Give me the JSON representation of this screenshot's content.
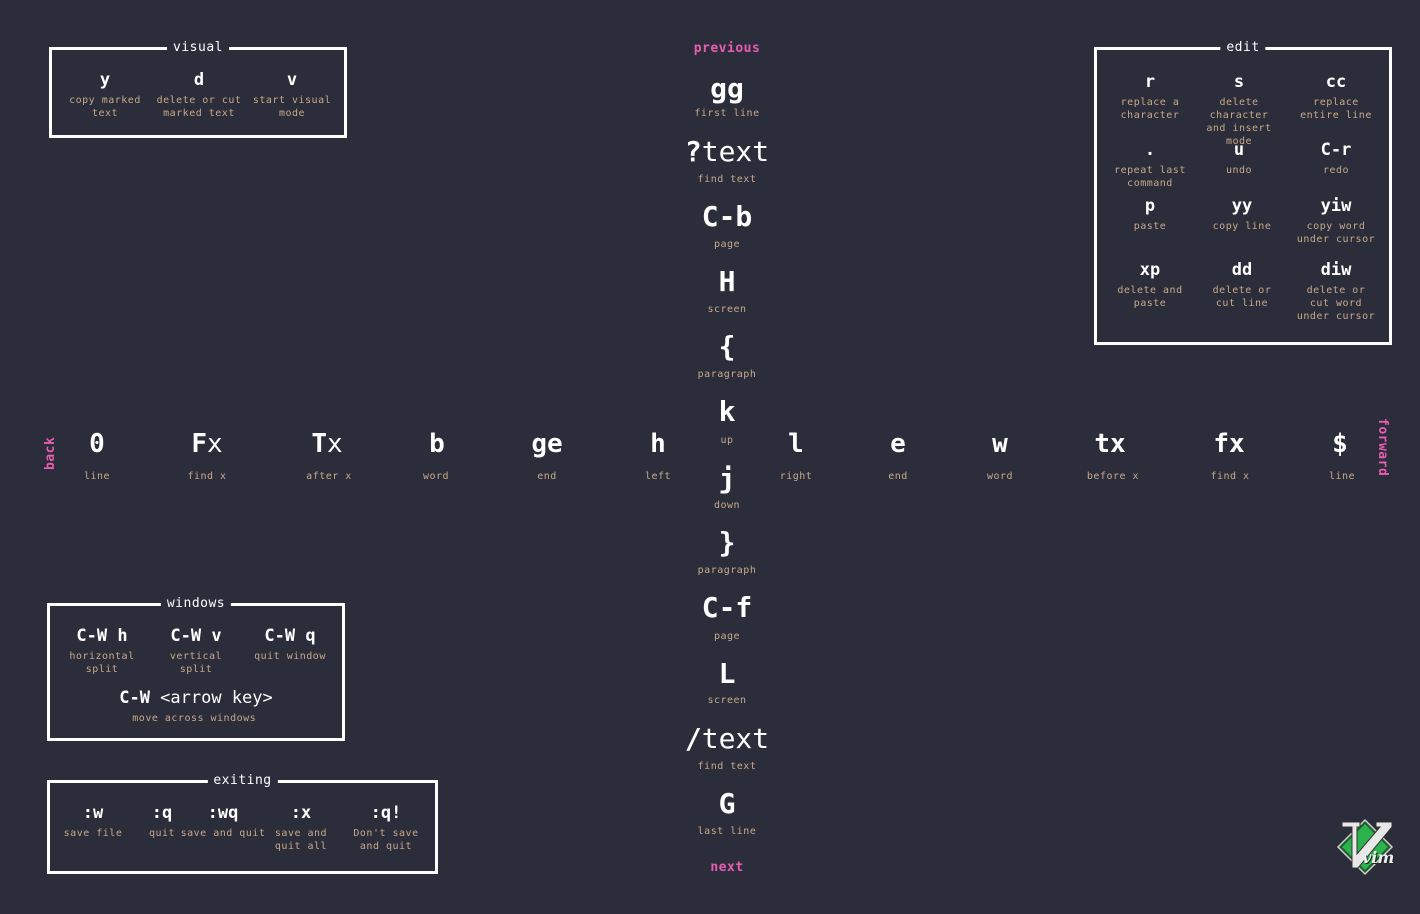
{
  "visual": {
    "title": "visual",
    "items": [
      {
        "key": "y",
        "desc": "copy marked text"
      },
      {
        "key": "d",
        "desc": "delete or cut marked text"
      },
      {
        "key": "v",
        "desc": "start visual mode"
      }
    ]
  },
  "edit": {
    "title": "edit",
    "items": [
      {
        "key": "r",
        "desc": "replace a character"
      },
      {
        "key": "s",
        "desc": "delete character and insert mode"
      },
      {
        "key": "cc",
        "desc": "replace entire line"
      },
      {
        "key": ".",
        "desc": "repeat last command"
      },
      {
        "key": "u",
        "desc": "undo"
      },
      {
        "key": "C-r",
        "desc": "redo"
      },
      {
        "key": "p",
        "desc": "paste"
      },
      {
        "key": "yy",
        "desc": "copy line"
      },
      {
        "key": "yiw",
        "desc": "copy word under cursor"
      },
      {
        "key": "xp",
        "desc": "delete and paste"
      },
      {
        "key": "dd",
        "desc": "delete or cut line"
      },
      {
        "key": "diw",
        "desc": "delete or cut word under cursor"
      }
    ]
  },
  "windows": {
    "title": "windows",
    "items": [
      {
        "key": "C-W h",
        "desc": "horizontal split"
      },
      {
        "key": "C-W v",
        "desc": "vertical split"
      },
      {
        "key": "C-W q",
        "desc": "quit window"
      }
    ],
    "arrow": {
      "key_prefix": "C-W ",
      "key_suffix": "<arrow key>",
      "desc": "move across windows"
    }
  },
  "exiting": {
    "title": "exiting",
    "items": [
      {
        "key": ":w",
        "desc": "save file"
      },
      {
        "key": ":q",
        "desc": "quit"
      },
      {
        "key": ":wq",
        "desc": "save and quit"
      },
      {
        "key": ":x",
        "desc": "save and quit all"
      },
      {
        "key": ":q!",
        "desc": "Don't save and quit"
      }
    ]
  },
  "vertical": {
    "previous": "previous",
    "next": "next",
    "items": [
      {
        "key": "gg",
        "desc": "first line"
      },
      {
        "key": "?text",
        "desc": "find text"
      },
      {
        "key": "C-b",
        "desc": "page"
      },
      {
        "key": "H",
        "desc": "screen"
      },
      {
        "key": "{",
        "desc": "paragraph"
      },
      {
        "key": "k",
        "desc": "up"
      },
      {
        "key": "j",
        "desc": "down"
      },
      {
        "key": "}",
        "desc": "paragraph"
      },
      {
        "key": "C-f",
        "desc": "page"
      },
      {
        "key": "L",
        "desc": "screen"
      },
      {
        "key": "/text",
        "desc": "find text"
      },
      {
        "key": "G",
        "desc": "last line"
      }
    ]
  },
  "horizontal": {
    "back": "back",
    "forward": "forward",
    "items": [
      {
        "key": "0",
        "desc": "line"
      },
      {
        "key": "Fx",
        "desc": "find x"
      },
      {
        "key": "Tx",
        "desc": "after x"
      },
      {
        "key": "b",
        "desc": "word"
      },
      {
        "key": "ge",
        "desc": "end"
      },
      {
        "key": "h",
        "desc": "left"
      },
      {
        "key": "l",
        "desc": "right"
      },
      {
        "key": "e",
        "desc": "end"
      },
      {
        "key": "w",
        "desc": "word"
      },
      {
        "key": "tx",
        "desc": "before x"
      },
      {
        "key": "fx",
        "desc": "find x"
      },
      {
        "key": "$",
        "desc": "line"
      }
    ]
  },
  "logo": {
    "text": "vim",
    "colors": {
      "green": "#2bb24c",
      "dark": "#1f5c2e"
    }
  },
  "colors": {
    "background": "#2b2d3a",
    "accent": "#e85db1",
    "desc": "#c8a98a",
    "text": "#ffffff"
  }
}
